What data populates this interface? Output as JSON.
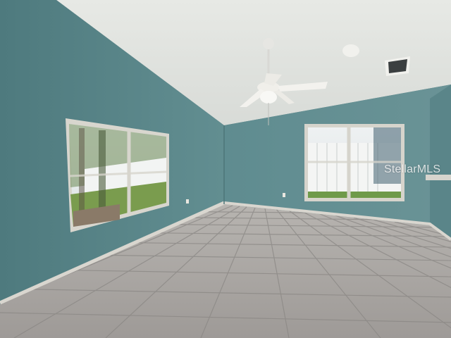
{
  "photo": {
    "watermark_text": "StellarMLS",
    "colors": {
      "wall": "#5f8a8d",
      "wall_dark": "#4e7679",
      "ceiling": "#e9ebe7",
      "floor_tile": "#a9a6a4",
      "grout": "#858280",
      "baseboard": "#d8d6d0",
      "window_frame": "#d9d7cf"
    }
  }
}
